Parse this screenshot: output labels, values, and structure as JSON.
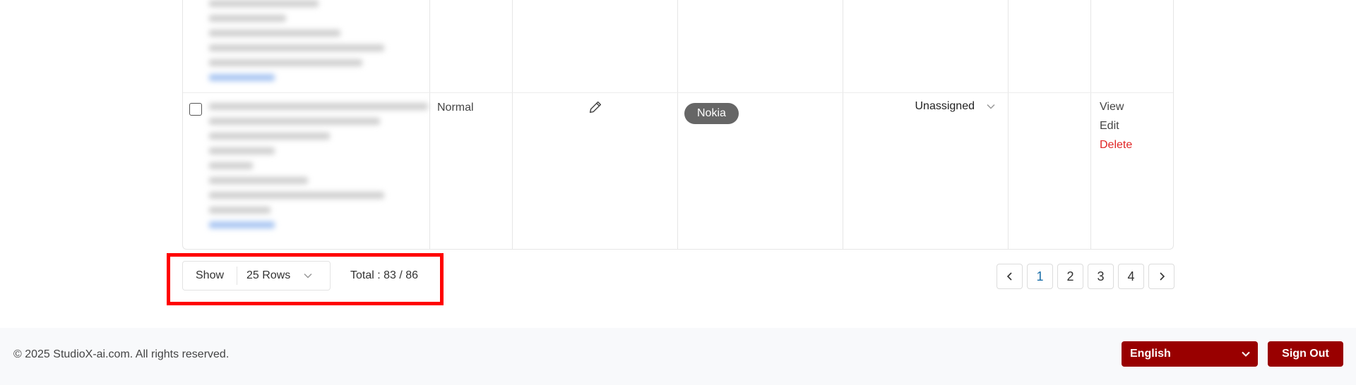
{
  "table": {
    "row": {
      "priority": "Normal",
      "tag": "Nokia",
      "assignee": "Unassigned",
      "actions": [
        "View",
        "Edit",
        "Delete"
      ],
      "icons": {
        "edit_cell": "pencil-icon",
        "assignee_dropdown": "chevron-down-icon"
      }
    }
  },
  "pagination": {
    "show_label": "Show",
    "rows_value": "25 Rows",
    "total": "Total : 83 / 86",
    "pages": [
      "1",
      "2",
      "3",
      "4"
    ],
    "current_page": "1"
  },
  "footer": {
    "copyright": "© 2025 StudioX-ai.com.  All rights reserved.",
    "language": "English",
    "sign_out": "Sign Out"
  },
  "colors": {
    "brand": "#990000",
    "highlight": "#ff0000",
    "tag_bg": "#666666",
    "delete": "#e02424",
    "active_page": "#1a6ea8"
  }
}
